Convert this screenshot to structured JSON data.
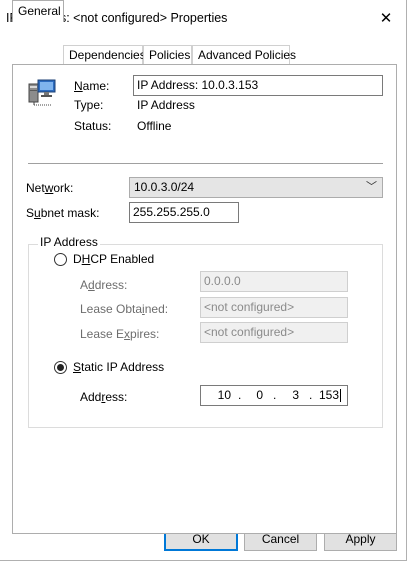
{
  "window": {
    "title": "IP Address: <not configured> Properties",
    "close_icon": "close-icon"
  },
  "tabs": [
    {
      "label": "General",
      "active": true
    },
    {
      "label": "Dependencies",
      "active": false
    },
    {
      "label": "Policies",
      "active": false
    },
    {
      "label": "Advanced Policies",
      "active": false
    }
  ],
  "resource": {
    "icon": "server-network-icon",
    "name_label": "Name:",
    "name_value": "IP Address: 10.0.3.153",
    "type_label": "Type:",
    "type_value": "IP Address",
    "status_label": "Status:",
    "status_value": "Offline"
  },
  "network": {
    "network_label": "Network:",
    "network_value": "10.0.3.0/24",
    "subnet_label": "Subnet mask:",
    "subnet_value": "255.255.255.0"
  },
  "ip_group": {
    "legend": "IP Address",
    "dhcp": {
      "label": "DHCP Enabled",
      "selected": false,
      "address_label": "Address:",
      "address_value": "0.0.0.0",
      "lease_obtained_label": "Lease Obtained:",
      "lease_obtained_value": "<not configured>",
      "lease_expires_label": "Lease Expires:",
      "lease_expires_value": "<not configured>"
    },
    "static": {
      "label": "Static IP Address",
      "selected": true,
      "address_label": "Address:",
      "octets": [
        "10",
        "0",
        "3",
        "153"
      ]
    }
  },
  "buttons": {
    "ok": "OK",
    "cancel": "Cancel",
    "apply": "Apply"
  }
}
